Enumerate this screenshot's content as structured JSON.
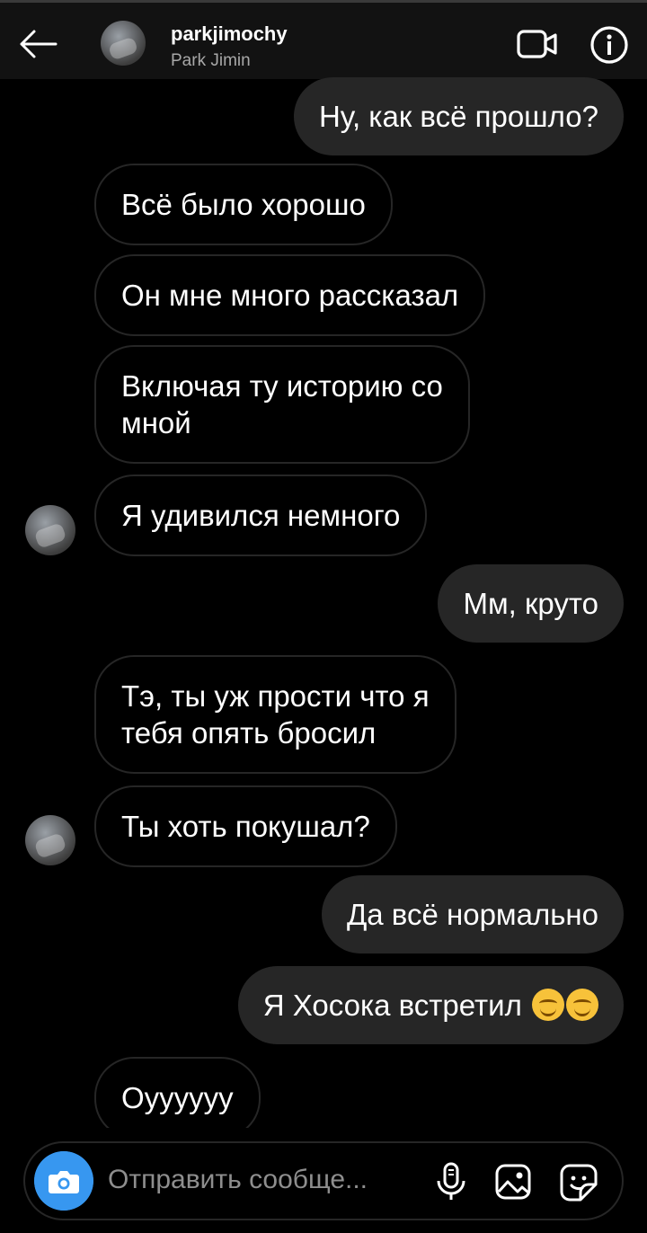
{
  "header": {
    "username": "parkjimochy",
    "full_name": "Park Jimin",
    "icons": [
      "back-arrow-icon",
      "video-call-icon",
      "info-icon"
    ]
  },
  "messages": [
    {
      "from": "me",
      "text": "Ну, как всё прошло?"
    },
    {
      "from": "them",
      "text": "Всё было хорошо"
    },
    {
      "from": "them",
      "text": "Он мне много рассказал"
    },
    {
      "from": "them",
      "line1": "Включая ту историю со",
      "line2": "мной"
    },
    {
      "from": "them",
      "text": "Я удивился немного"
    },
    {
      "from": "me",
      "text": "Мм, круто"
    },
    {
      "from": "them",
      "line1": "Тэ, ты уж прости что я",
      "line2": "тебя опять бросил"
    },
    {
      "from": "them",
      "text": "Ты хоть покушал?"
    },
    {
      "from": "me",
      "text": "Да всё нормально"
    },
    {
      "from": "me",
      "text": "Я Хосока встретил",
      "emojis": [
        "smiling-face-icon",
        "blushing-face-icon"
      ]
    },
    {
      "from": "them",
      "text": "Оуууууу"
    }
  ],
  "composer": {
    "placeholder": "Отправить сообще...",
    "icons": [
      "camera-icon",
      "microphone-icon",
      "gallery-icon",
      "sticker-icon"
    ]
  },
  "colors": {
    "background": "#000000",
    "header": "#121212",
    "outgoing_bubble": "#262626",
    "incoming_border": "#262626",
    "camera_button": "#3797f0"
  }
}
